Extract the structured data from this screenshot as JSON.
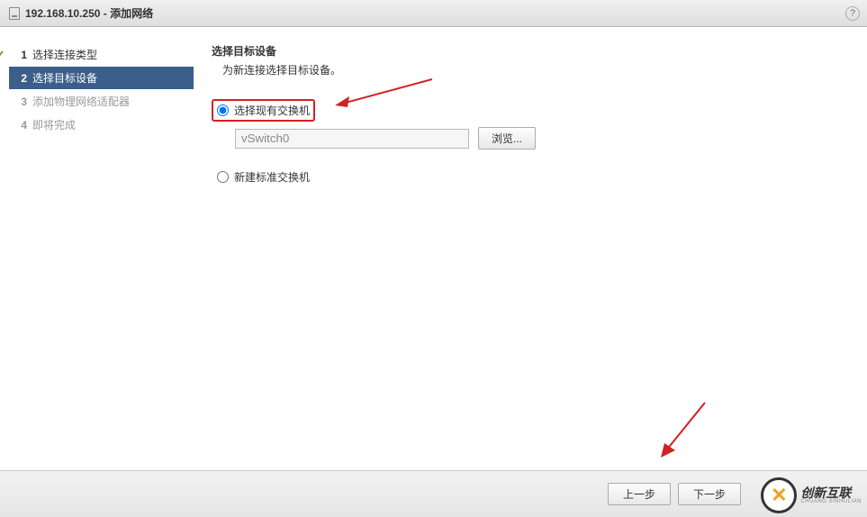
{
  "titlebar": {
    "host": "192.168.10.250",
    "separator": " - ",
    "action": "添加网络"
  },
  "sidebar": {
    "steps": [
      {
        "num": "1",
        "label": "选择连接类型",
        "state": "done"
      },
      {
        "num": "2",
        "label": "选择目标设备",
        "state": "active"
      },
      {
        "num": "3",
        "label": "添加物理网络适配器",
        "state": "pending"
      },
      {
        "num": "4",
        "label": "即将完成",
        "state": "pending"
      }
    ]
  },
  "content": {
    "heading": "选择目标设备",
    "subheading": "为新连接选择目标设备。",
    "option_existing": "选择现有交换机",
    "switch_value": "vSwitch0",
    "browse_label": "浏览...",
    "option_new": "新建标准交换机"
  },
  "footer": {
    "back": "上一步",
    "next": "下一步"
  },
  "logo": {
    "text": "创新互联",
    "sub": "CHUANG XINHULIAN"
  }
}
